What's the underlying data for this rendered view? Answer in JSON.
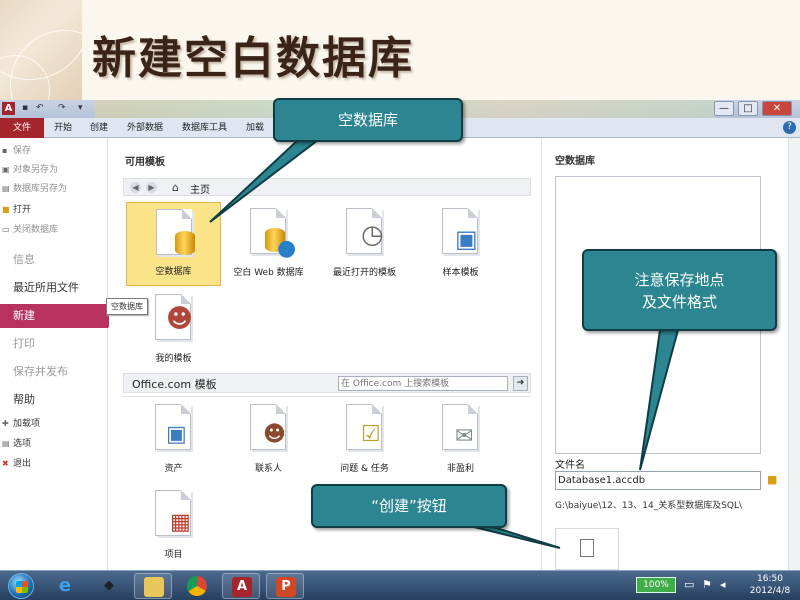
{
  "slide": {
    "title": "新建空白数据库"
  },
  "window": {
    "app_icon": "A",
    "tabs": [
      "文件",
      "开始",
      "创建",
      "外部数据",
      "数据库工具",
      "加载"
    ],
    "controls": {
      "minimize": "—",
      "maximize": "□",
      "close": "✕"
    }
  },
  "nav": {
    "save": "保存",
    "save_object_as": "对象另存为",
    "save_db_as": "数据库另存为",
    "open": "打开",
    "close_db": "关闭数据库",
    "info": "信息",
    "recent": "最近所用文件",
    "new": "新建",
    "print": "打印",
    "save_publish": "保存并发布",
    "help": "帮助",
    "addins": "加载项",
    "options": "选项",
    "exit": "退出"
  },
  "main": {
    "available_templates": "可用模板",
    "home": "主页",
    "templates": [
      {
        "label": "空数据库",
        "icon": "blank-database-icon"
      },
      {
        "label": "空白 Web 数据库",
        "icon": "web-database-icon"
      },
      {
        "label": "最近打开的模板",
        "icon": "recent-clock-icon"
      },
      {
        "label": "样本模板",
        "icon": "sample-monitor-icon"
      },
      {
        "label": "我的模板",
        "icon": "my-templates-person-icon"
      }
    ],
    "tooltip": "空数据库",
    "office_section": "Office.com 模板",
    "search_placeholder": "在 Office.com 上搜索模板",
    "office_templates": [
      {
        "label": "资产",
        "icon": "computer-icon"
      },
      {
        "label": "联系人",
        "icon": "contact-card-icon"
      },
      {
        "label": "问题 & 任务",
        "icon": "clipboard-check-icon"
      },
      {
        "label": "非盈利",
        "icon": "envelope-icon"
      },
      {
        "label": "项目",
        "icon": "calendar-icon"
      }
    ]
  },
  "preview": {
    "title": "空数据库",
    "file_name_label": "文件名",
    "file_name_value": "Database1.accdb",
    "path": "G:\\baiyue\\12、13、14_关系型数据库及SQL\\"
  },
  "callouts": {
    "blank_db": "空数据库",
    "save_note_line1": "注意保存地点",
    "save_note_line2": "及文件格式",
    "create_note": "“创建”按钮"
  },
  "taskbar": {
    "battery": "100%",
    "time": "16:50",
    "date": "2012/4/8"
  },
  "colors": {
    "accent": "#b8325f",
    "file_tab": "#a4262c",
    "callout": "#2b8691",
    "selected_tile": "#fbe38a"
  }
}
